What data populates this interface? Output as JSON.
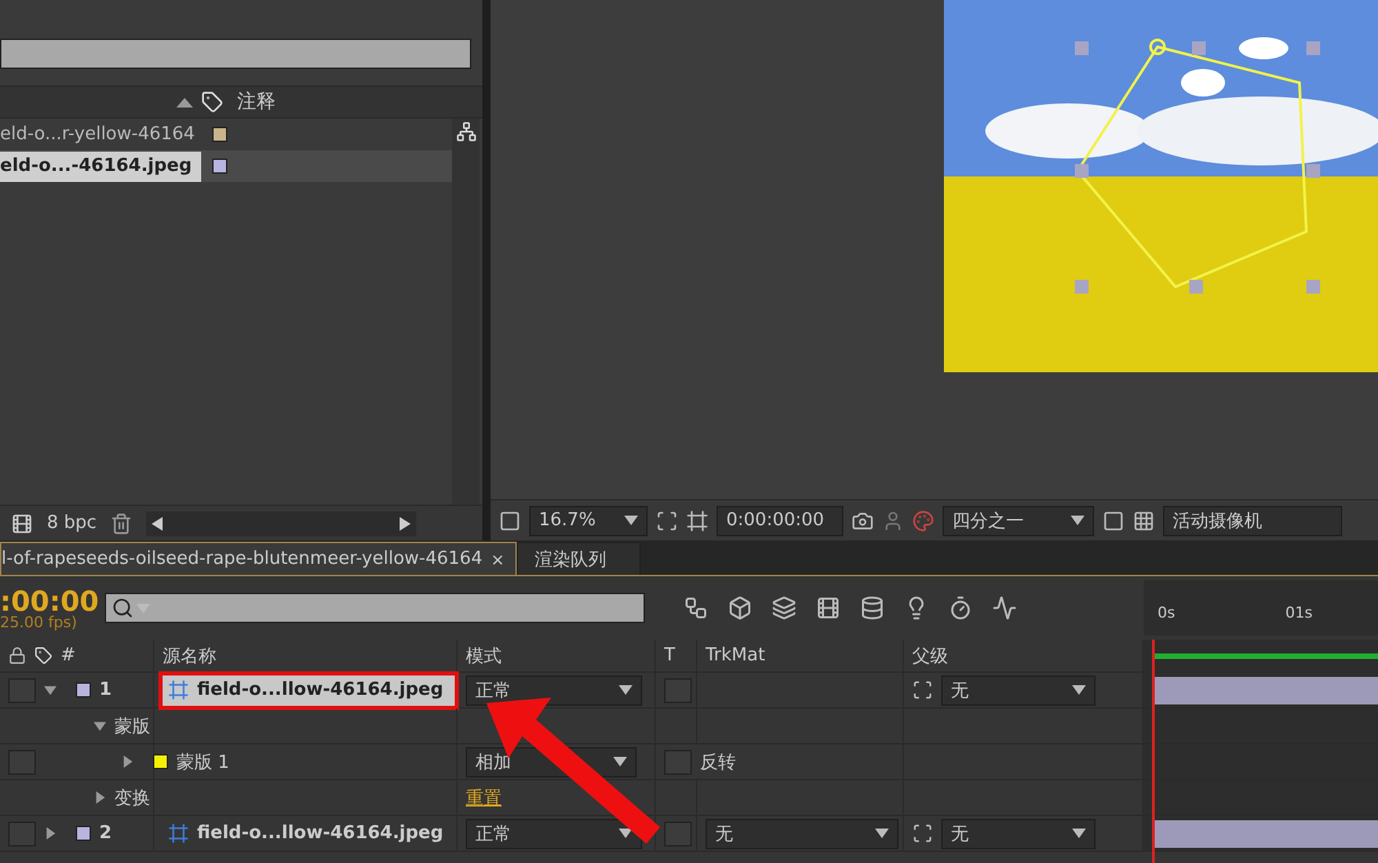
{
  "project": {
    "comment_column": "注释",
    "items": [
      {
        "name": "eld-o...r-yellow-46164",
        "color": "#c8b48a",
        "selected": false
      },
      {
        "name": "eld-o...-46164.jpeg",
        "color": "#b8b4e0",
        "selected": true
      }
    ],
    "bpc": "8 bpc"
  },
  "viewer": {
    "zoom": "16.7%",
    "timecode": "0:00:00:00",
    "resolution": "四分之一",
    "camera": "活动摄像机"
  },
  "timeline": {
    "tabs": [
      {
        "label": "l-of-rapeseeds-oilseed-rape-blutenmeer-yellow-46164",
        "selected": true,
        "close": "×"
      },
      {
        "label": "渲染队列",
        "selected": false
      }
    ],
    "timecode": ":00:00",
    "fps": "25.00 fps)",
    "columns": {
      "number": "#",
      "source": "源名称",
      "mode": "模式",
      "t": "T",
      "trkmat": "TrkMat",
      "parent": "父级"
    },
    "ruler": [
      "0s",
      "01s"
    ],
    "rows": [
      {
        "kind": "layer",
        "number": "1",
        "name": "field-o...llow-46164.jpeg",
        "color": "#b8b4e0",
        "expanded": true,
        "highlighted": true,
        "mode": "正常",
        "preserve_transparency": false,
        "parent": "无"
      },
      {
        "kind": "group",
        "label": "蒙版",
        "expanded": true
      },
      {
        "kind": "mask",
        "label": "蒙版",
        "index": "1",
        "color": "#f5f000",
        "expanded": false,
        "mode": "相加",
        "invert_label": "反转",
        "inverted": false
      },
      {
        "kind": "property",
        "label": "变换",
        "expanded": false,
        "value": "重置"
      },
      {
        "kind": "layer",
        "number": "2",
        "name": "field-o...llow-46164.jpeg",
        "color": "#b8b4e0",
        "expanded": false,
        "highlighted": false,
        "mode": "正常",
        "preserve_transparency": false,
        "trkmat": "无",
        "parent": "无"
      }
    ]
  }
}
